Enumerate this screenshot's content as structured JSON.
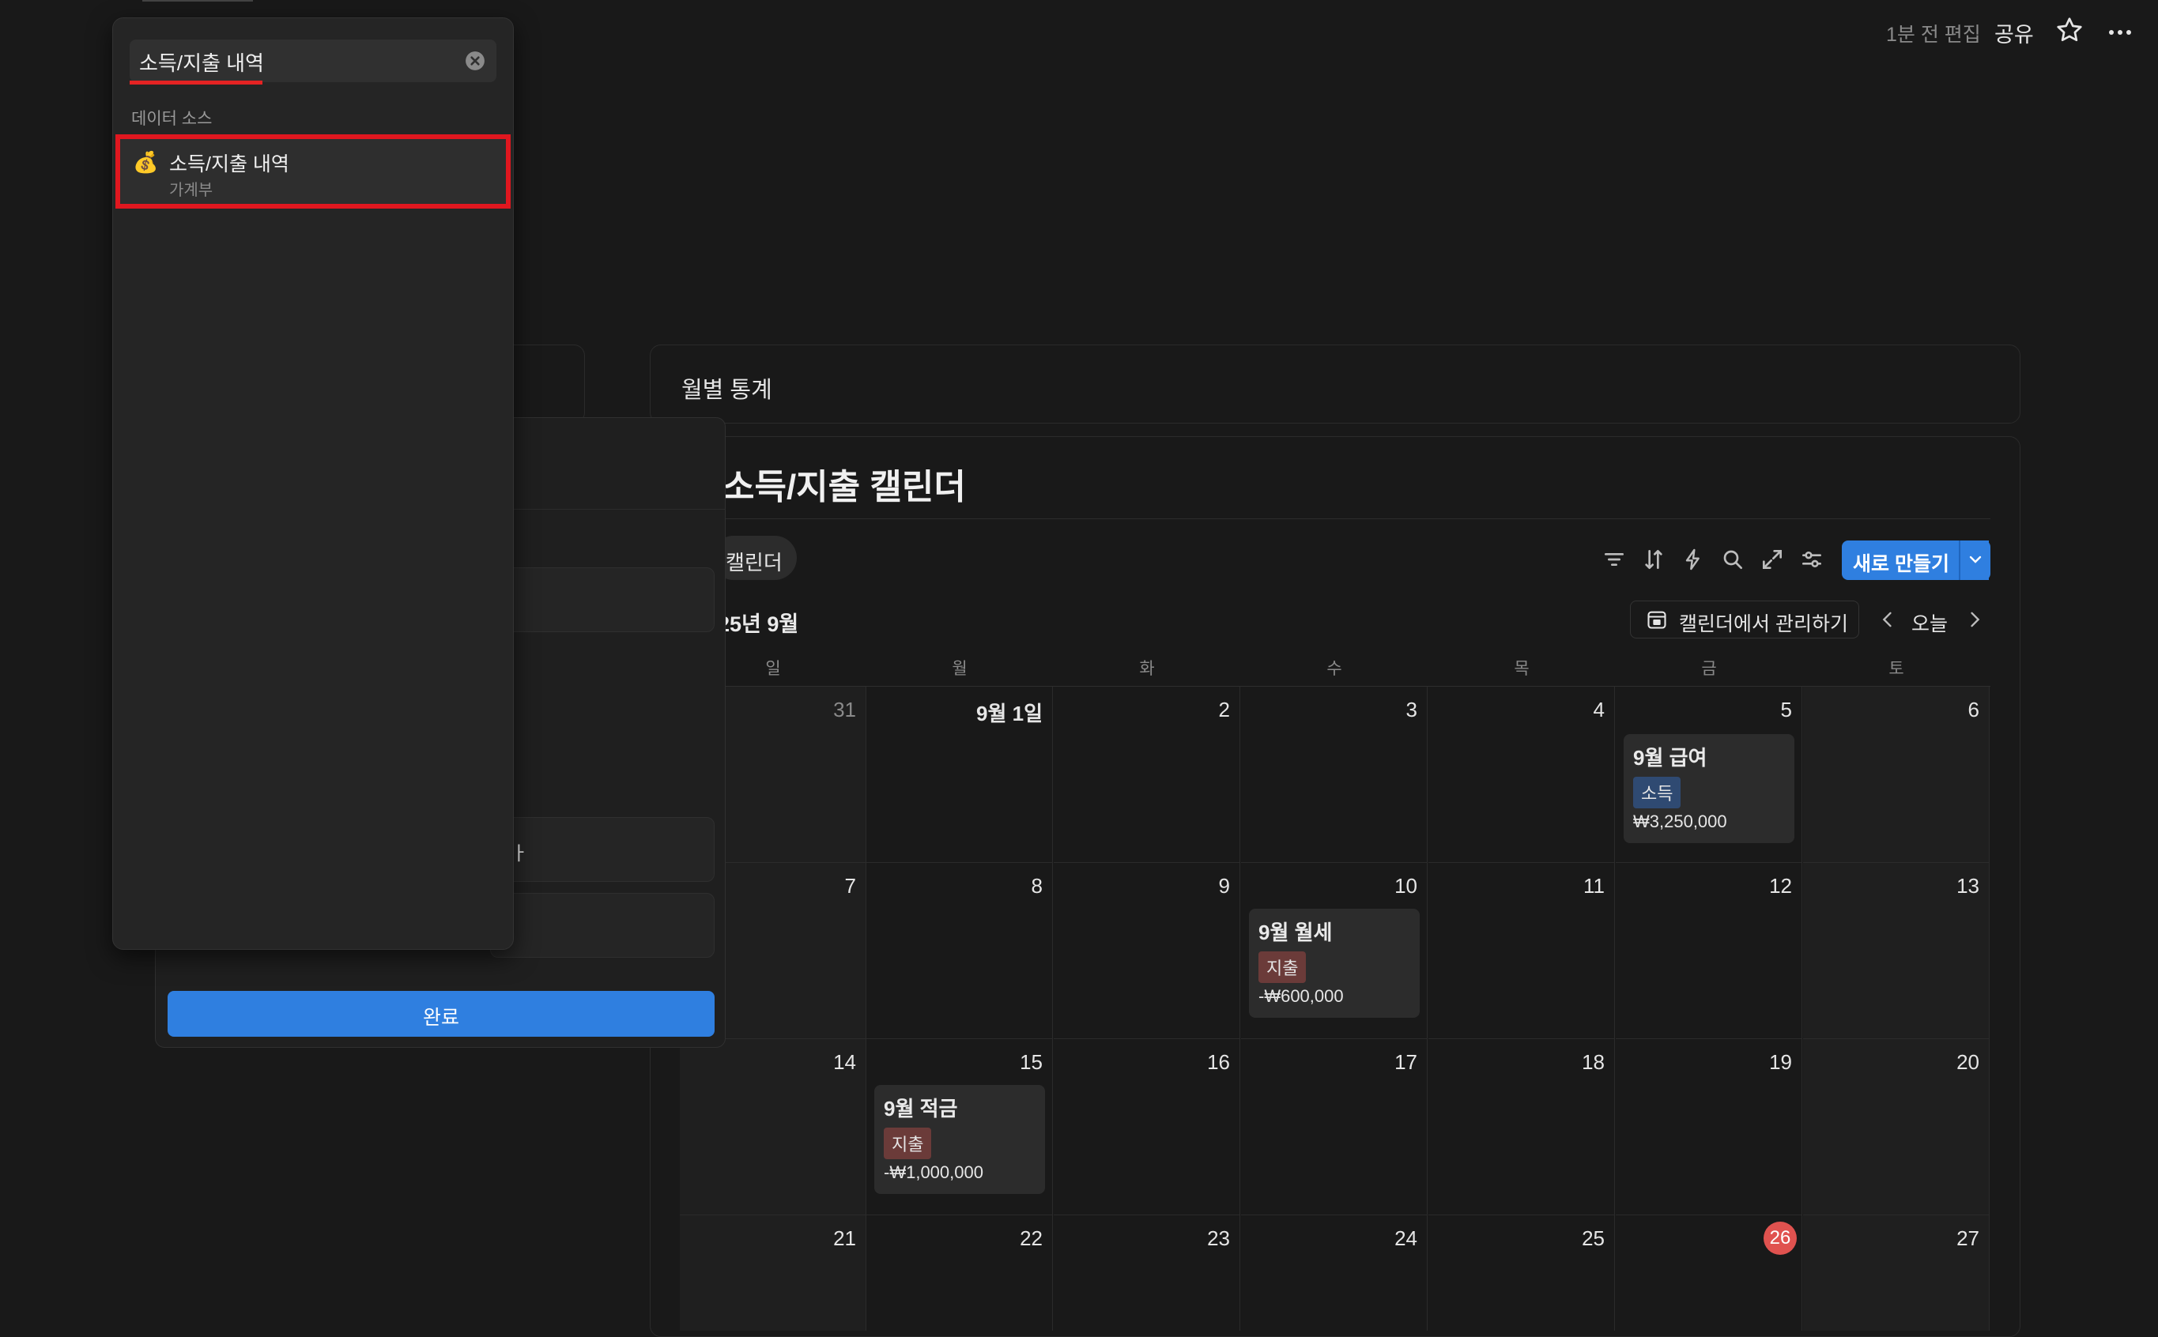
{
  "topbar": {
    "edited": "1분 전 편집",
    "share": "공유"
  },
  "stats": {
    "title": "월별 통계"
  },
  "calendar": {
    "title": "소득/지출 캘린더",
    "view_tab": "캘린더",
    "new_button": "새로 만들기",
    "month_label": "25년 9월",
    "manage_button": "캘린더에서 관리하기",
    "today_button": "오늘",
    "weekdays": [
      "일",
      "월",
      "화",
      "수",
      "목",
      "금",
      "토"
    ],
    "weeks": [
      [
        "31",
        "9월 1일",
        "2",
        "3",
        "4",
        "5",
        "6"
      ],
      [
        "7",
        "8",
        "9",
        "10",
        "11",
        "12",
        "13"
      ],
      [
        "14",
        "15",
        "16",
        "17",
        "18",
        "19",
        "20"
      ],
      [
        "21",
        "22",
        "23",
        "24",
        "25",
        "26",
        "27"
      ]
    ],
    "today": "26",
    "events": {
      "salary": {
        "title": "9월 급여",
        "tag": "소득",
        "amount": "₩3,250,000"
      },
      "rent": {
        "title": "9월 월세",
        "tag": "지출",
        "amount": "-₩600,000"
      },
      "savings": {
        "title": "9월 적금",
        "tag": "지출",
        "amount": "-₩1,000,000"
      }
    }
  },
  "panel": {
    "fragment": "ㅏ",
    "done_button": "완료"
  },
  "popup": {
    "search_value": "소득/지출 내역",
    "section_label": "데이터 소스",
    "result": {
      "icon": "money-bag-icon",
      "title": "소득/지출 내역",
      "subtitle": "가계부"
    }
  },
  "colors": {
    "accent": "#2f7fe0",
    "highlight": "#e0171f",
    "today": "#e0524f",
    "income_tag": "#2f4a72",
    "expense_tag": "#6b3b39"
  }
}
